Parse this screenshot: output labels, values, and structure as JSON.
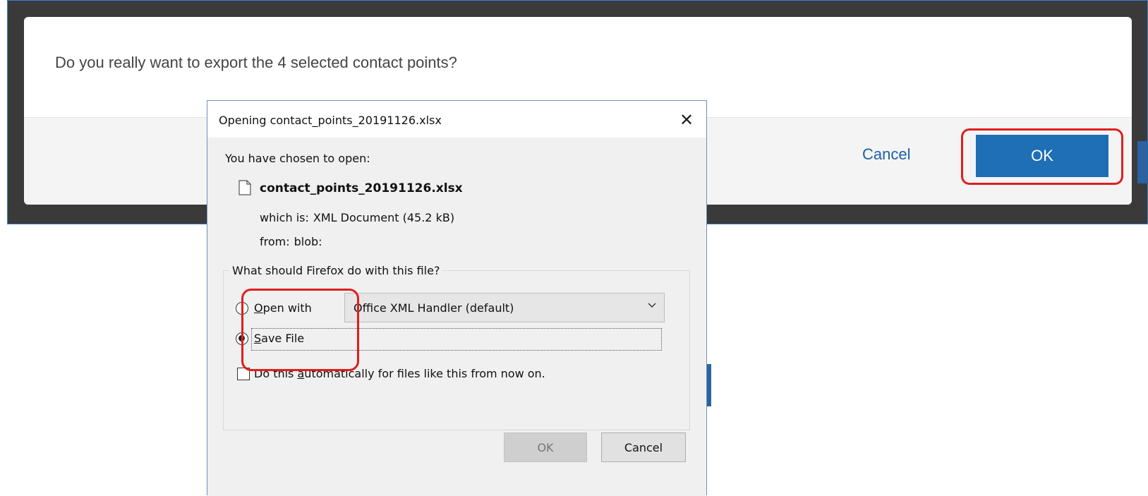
{
  "web_modal": {
    "question": "Do you really want to export the 4 selected contact points?",
    "cancel_label": "Cancel",
    "ok_label": "OK"
  },
  "firefox_dialog": {
    "title": "Opening contact_points_20191126.xlsx",
    "close_glyph": "✕",
    "chosen_label": "You have chosen to open:",
    "filename": "contact_points_20191126.xlsx",
    "which_is_label": "which is:",
    "which_is_value": "XML Document (45.2 kB)",
    "from_label": "from:",
    "from_value": "blob:",
    "group_legend": "What should Firefox do with this file?",
    "open_with_label": "Open with",
    "open_with_selected": "Office XML Handler (default)",
    "save_file_label": "Save File",
    "save_file_checked": true,
    "auto_label": "Do this automatically for files like this from now on.",
    "auto_checked": false,
    "ok_label": "OK",
    "cancel_label": "Cancel",
    "icons": {
      "file": "file-icon",
      "close": "close-icon",
      "chevron": "chevron-down-icon"
    }
  },
  "colors": {
    "highlight": "#e01e1e",
    "primary_button": "#1e6fb6",
    "link": "#1e5fa8"
  }
}
